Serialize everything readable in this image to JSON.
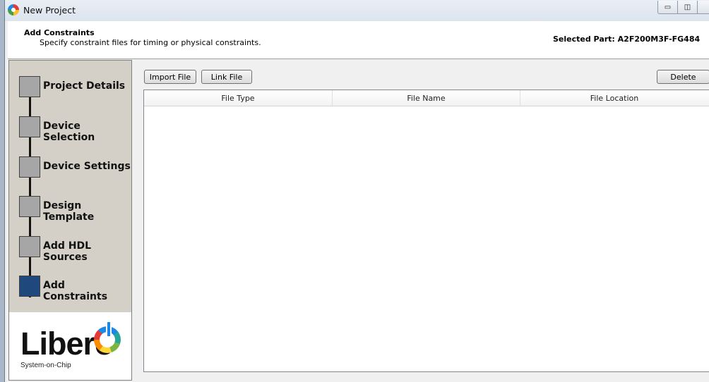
{
  "window": {
    "title": "New Project",
    "minimize_glyph": "▭",
    "maximize_glyph": "◫",
    "close_glyph": ""
  },
  "header": {
    "title": "Add Constraints",
    "subtitle": "Specify constraint files for timing or physical constraints.",
    "selected_part": "Selected Part: A2F200M3F-FG484"
  },
  "steps": [
    {
      "label": "Project Details",
      "active": false
    },
    {
      "label": "Device Selection",
      "active": false
    },
    {
      "label": "Device Settings",
      "active": false
    },
    {
      "label": "Design Template",
      "active": false
    },
    {
      "label": "Add HDL Sources",
      "active": false
    },
    {
      "label": "Add Constraints",
      "active": true
    }
  ],
  "logo": {
    "word": "Libero",
    "tagline": "System-on-Chip"
  },
  "toolbar": {
    "import_label": "Import File",
    "link_label": "Link File",
    "delete_label": "Delete"
  },
  "table": {
    "columns": [
      "File Type",
      "File Name",
      "File Location"
    ],
    "rows": []
  },
  "colors": {
    "step_inactive": "#a6a6a6",
    "step_active": "#1f497d",
    "steps_panel": "#d4d0c8"
  }
}
